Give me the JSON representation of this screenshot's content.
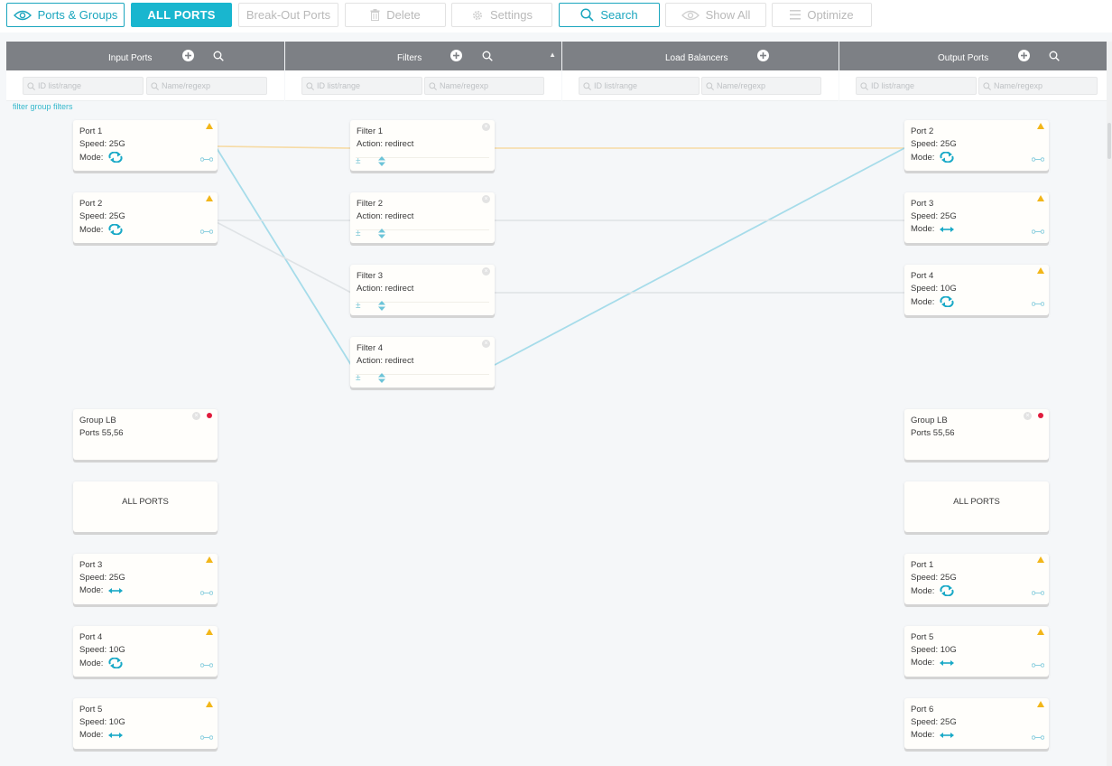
{
  "toolbar": {
    "ports_groups": "Ports & Groups",
    "all_ports": "ALL PORTS",
    "breakout": "Break-Out Ports",
    "delete": "Delete",
    "settings": "Settings",
    "search": "Search",
    "show_all": "Show All",
    "optimize": "Optimize"
  },
  "columns": {
    "input": "Input Ports",
    "filters": "Filters",
    "load_balancers": "Load Balancers",
    "output": "Output Ports"
  },
  "placeholders": {
    "id": "ID list/range",
    "name": "Name/regexp"
  },
  "filter_group_link": "filter group filters",
  "input_cards": [
    {
      "name": "Port 1",
      "speed": "Speed: 25G",
      "mode_label": "Mode:",
      "mode_icon": "loop-icon"
    },
    {
      "name": "Port 2",
      "speed": "Speed: 25G",
      "mode_label": "Mode:",
      "mode_icon": "loop-icon"
    }
  ],
  "input_group": {
    "name": "Group LB",
    "ports": "Ports 55,56"
  },
  "input_all": "ALL PORTS",
  "input_lower": [
    {
      "name": "Port 3",
      "speed": "Speed: 25G",
      "mode_label": "Mode:",
      "mode_icon": "arrows-icon"
    },
    {
      "name": "Port 4",
      "speed": "Speed: 10G",
      "mode_label": "Mode:",
      "mode_icon": "loop-icon"
    },
    {
      "name": "Port 5",
      "speed": "Speed: 10G",
      "mode_label": "Mode:",
      "mode_icon": "arrows-icon"
    }
  ],
  "filters": [
    {
      "name": "Filter 1",
      "action": "Action: redirect",
      "plusminus": "±"
    },
    {
      "name": "Filter 2",
      "action": "Action: redirect",
      "plusminus": "±"
    },
    {
      "name": "Filter 3",
      "action": "Action: redirect",
      "plusminus": "±"
    },
    {
      "name": "Filter 4",
      "action": "Action: redirect",
      "plusminus": "±"
    }
  ],
  "output_cards": [
    {
      "name": "Port 2",
      "speed": "Speed: 25G",
      "mode_label": "Mode:",
      "mode_icon": "loop-icon"
    },
    {
      "name": "Port 3",
      "speed": "Speed: 25G",
      "mode_label": "Mode:",
      "mode_icon": "arrows-icon"
    },
    {
      "name": "Port 4",
      "speed": "Speed: 10G",
      "mode_label": "Mode:",
      "mode_icon": "loop-icon"
    }
  ],
  "output_group": {
    "name": "Group LB",
    "ports": "Ports 55,56"
  },
  "output_all": "ALL PORTS",
  "output_lower": [
    {
      "name": "Port 1",
      "speed": "Speed: 25G",
      "mode_label": "Mode:",
      "mode_icon": "loop-icon"
    },
    {
      "name": "Port 5",
      "speed": "Speed: 10G",
      "mode_label": "Mode:",
      "mode_icon": "arrows-icon"
    },
    {
      "name": "Port 6",
      "speed": "Speed: 25G",
      "mode_label": "Mode:",
      "mode_icon": "arrows-icon"
    }
  ],
  "colors": {
    "accent": "#19b6cf",
    "header_bg": "#7d8085",
    "warning": "#f2b619",
    "alert": "#e01b3c",
    "link_orange": "#f6dba5",
    "link_blue": "#a6dcea",
    "link_gray": "#dfe3e6"
  }
}
